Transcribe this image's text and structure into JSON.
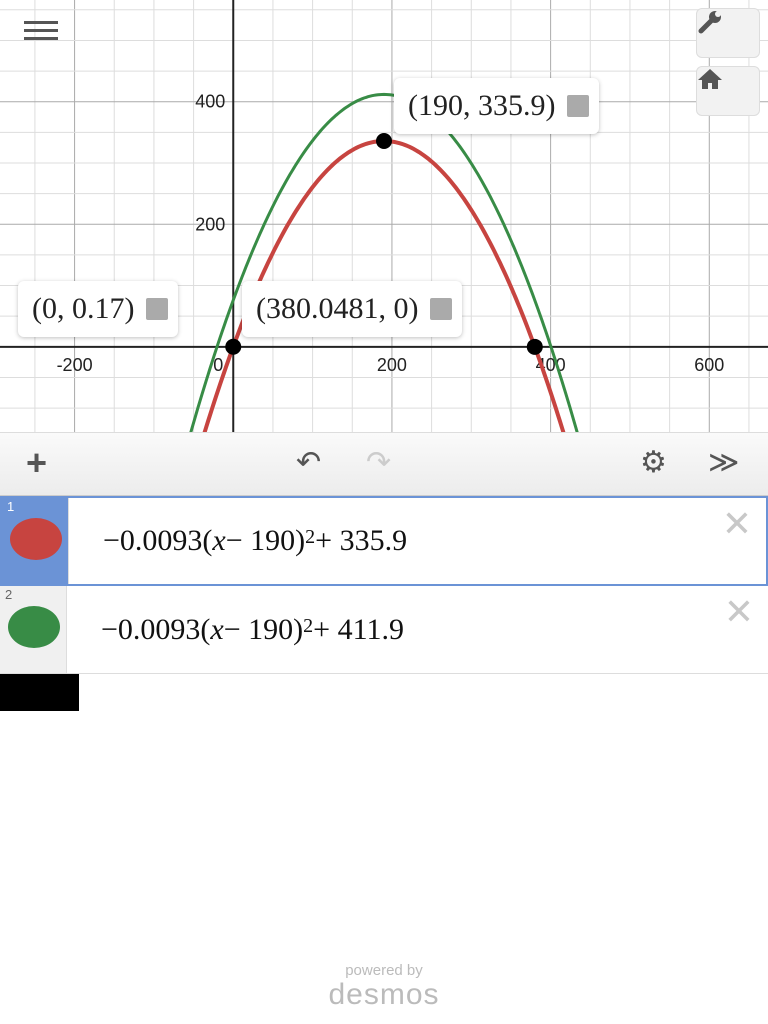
{
  "graph": {
    "x_ticks": [
      "-200",
      "0",
      "200",
      "400",
      "600"
    ],
    "y_ticks": [
      "200",
      "400"
    ],
    "labels": {
      "vertex": "(190, 335.9)",
      "y_intercept": "(0, 0.17)",
      "x_intercept": "(380.0481, 0)"
    }
  },
  "chart_data": {
    "type": "line",
    "xlim": [
      -294,
      674
    ],
    "ylim": [
      -139,
      566
    ],
    "grid": true,
    "series": [
      {
        "name": "1",
        "a": -0.0093,
        "h": 190,
        "k": 335.9,
        "color": "#c74440"
      },
      {
        "name": "2",
        "a": -0.0093,
        "h": 190,
        "k": 411.9,
        "color": "#388c46"
      }
    ],
    "points": [
      [
        0,
        0.17
      ],
      [
        190,
        335.9
      ],
      [
        380.0481,
        0
      ]
    ]
  },
  "toolbar": {
    "add": "+",
    "undo": "↶",
    "redo": "↷",
    "settings": "⚙",
    "collapse": "≫"
  },
  "expressions": [
    {
      "num": "1",
      "pre": "−0.0093(",
      "x": "x",
      "mid": " − 190)",
      "exp": "2",
      "post": " + 335.9",
      "color": "#c74440"
    },
    {
      "num": "2",
      "pre": "−0.0093(",
      "x": "x",
      "mid": " − 190)",
      "exp": "2",
      "post": " + 411.9",
      "color": "#388c46"
    }
  ],
  "branding": {
    "line1": "powered by",
    "line2": "desmos"
  }
}
